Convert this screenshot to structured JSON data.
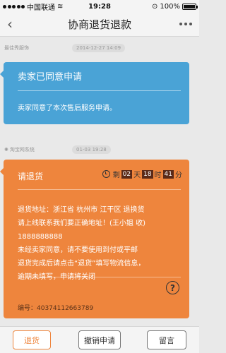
{
  "status_bar": {
    "carrier": "中国联通",
    "time": "19:28",
    "battery": "100%",
    "battery_level": 1.0
  },
  "nav": {
    "title": "协商退货退款"
  },
  "messages": [
    {
      "sender": "最佳秀服饰",
      "timestamp": "2014-12-27 14:09",
      "title": "卖家已同意申请",
      "body": "卖家同意了本次售后服务申请。"
    },
    {
      "sender": "淘宝网系统",
      "timestamp": "01-03 19:28",
      "title": "请退货",
      "countdown": {
        "prefix": "剩",
        "days": "02",
        "day_unit": "天",
        "hours": "18",
        "hour_unit": "时",
        "minutes": "41",
        "minute_unit": "分"
      },
      "body_lines": [
        "退货地址：浙江省 杭州市 江干区 退换货",
        "请上线联系我们要正确地址！(王小姐 收)",
        "1888888888",
        "未经卖家同意，请不要使用到付或平邮",
        "退货完成后请点击“退货”填写物流信息，",
        "逾期未填写，申请将关闭"
      ],
      "order_no": "编号：40374112663789"
    }
  ],
  "actions": {
    "return": "退货",
    "cancel": "撤销申请",
    "message": "留言"
  },
  "colors": {
    "blue_card": "#4aa3d6",
    "orange_card": "#ee853d",
    "accent": "#ee853d"
  }
}
